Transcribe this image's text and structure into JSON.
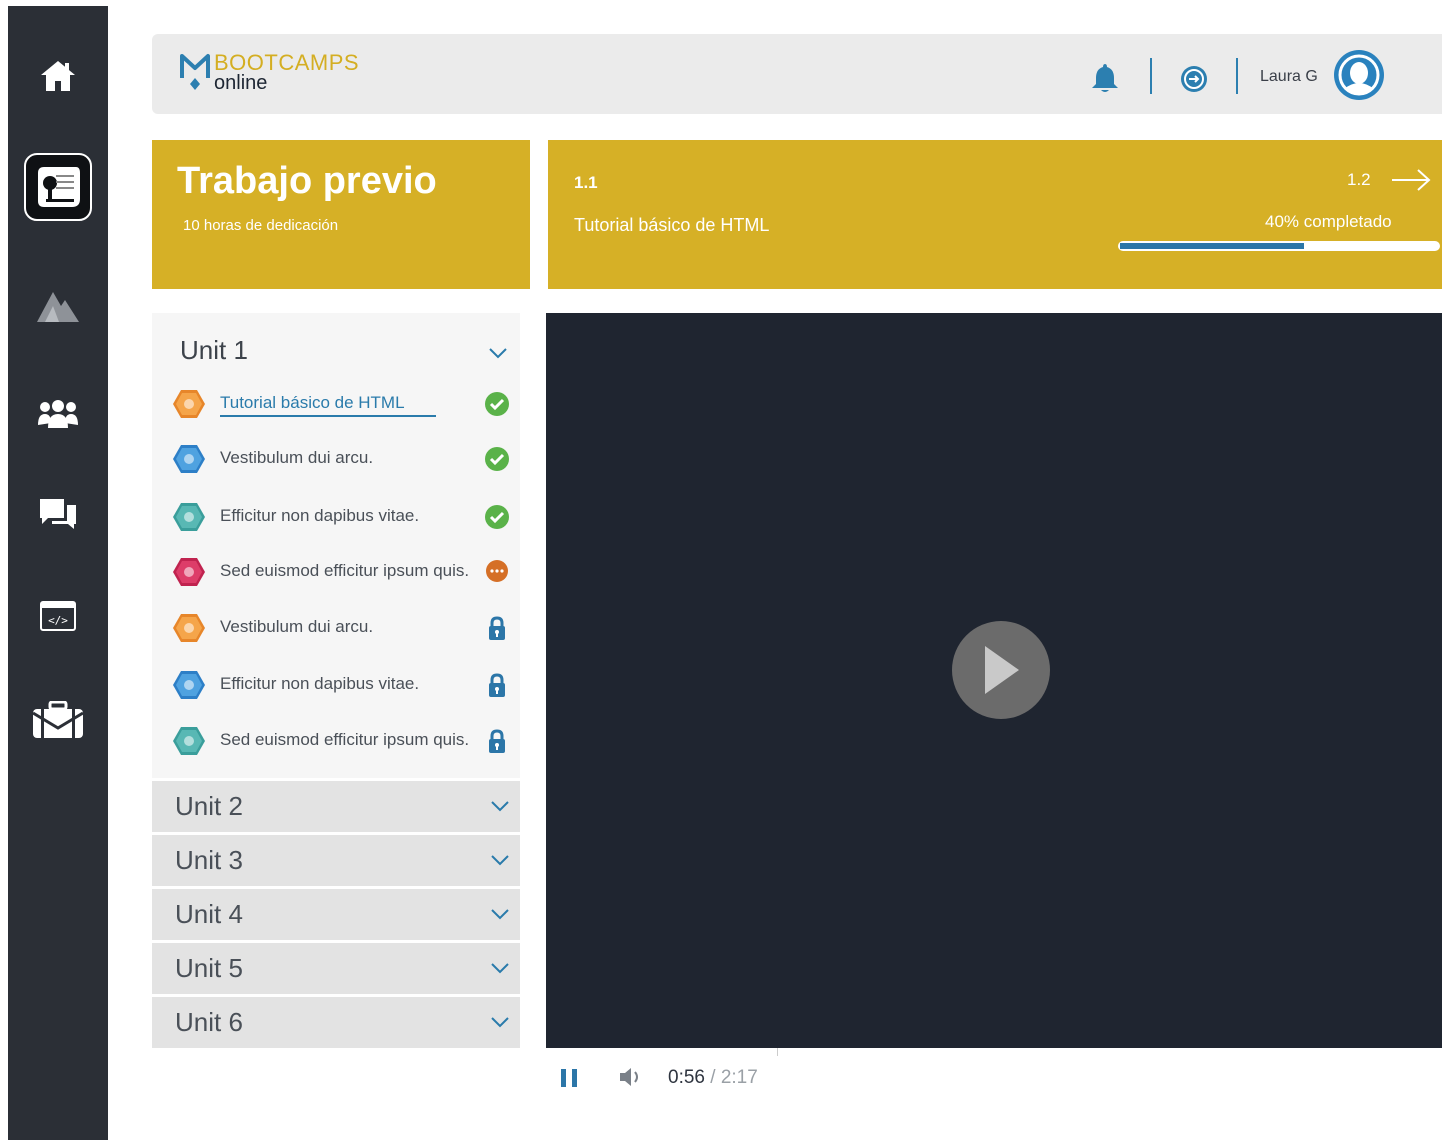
{
  "sidebar": {
    "items": [
      {
        "icon": "home-icon"
      },
      {
        "icon": "scroll-diploma-icon"
      },
      {
        "icon": "camp-tent-icon"
      },
      {
        "icon": "users-group-icon"
      },
      {
        "icon": "chat-bubbles-icon"
      },
      {
        "icon": "code-window-icon"
      },
      {
        "icon": "briefcase-icon"
      }
    ]
  },
  "header": {
    "logo_top": "BOOTCAMPS",
    "logo_bottom": "online",
    "user_name": "Laura G"
  },
  "module": {
    "title": "Trabajo previo",
    "subtitle": "10 horas de dedicación"
  },
  "lesson": {
    "number": "1.1",
    "name": "Tutorial básico de HTML",
    "next_number": "1.2",
    "progress_label": "40% completado",
    "progress_fraction": 0.4
  },
  "units": {
    "open": {
      "title": "Unit 1",
      "lessons": [
        {
          "label": "Tutorial básico de HTML",
          "icon": "html-hex-icon",
          "status": "completed"
        },
        {
          "label": "Vestibulum dui arcu.",
          "icon": "css-hex-icon",
          "status": "completed"
        },
        {
          "label": "Efficitur non dapibus vitae.",
          "icon": "css3-hex-icon",
          "status": "completed"
        },
        {
          "label": "Sed euismod efficitur ipsum quis.",
          "icon": "git-hex-icon",
          "status": "in-progress"
        },
        {
          "label": "Vestibulum dui arcu.",
          "icon": "html-hex-icon",
          "status": "locked"
        },
        {
          "label": "Efficitur non dapibus vitae.",
          "icon": "css-hex-icon",
          "status": "locked"
        },
        {
          "label": "Sed euismod efficitur ipsum quis.",
          "icon": "css3-hex-icon",
          "status": "locked"
        }
      ]
    },
    "collapsed": [
      "Unit 2",
      "Unit 3",
      "Unit 4",
      "Unit 5",
      "Unit 6"
    ]
  },
  "player": {
    "current_time": "0:56",
    "separator": " / ",
    "duration": "2:17"
  },
  "colors": {
    "sidebar": "#2b2f36",
    "accent_yellow": "#d6b026",
    "accent_blue": "#2c76a8",
    "video_bg": "#1f2530",
    "complete_green": "#5ab249",
    "progress_orange": "#d56f26"
  }
}
